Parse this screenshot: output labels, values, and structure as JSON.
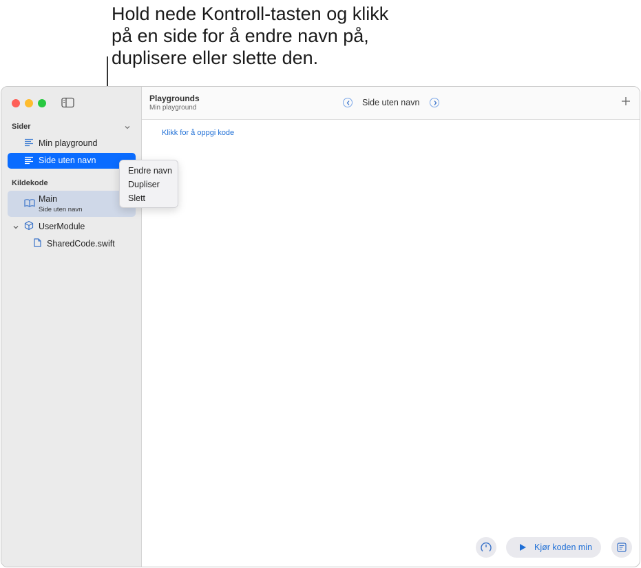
{
  "callout": {
    "text": "Hold nede Kontroll-tasten og klikk\npå en side for å endre navn på,\nduplisere eller slette den."
  },
  "sidebar": {
    "sections": {
      "pages": {
        "title": "Sider",
        "icon": "chevron-down-icon"
      },
      "source": {
        "title": "Kildekode"
      }
    },
    "pages": [
      {
        "label": "Min playground",
        "icon": "page-lines-icon",
        "selected": false
      },
      {
        "label": "Side uten navn",
        "icon": "page-lines-icon",
        "selected": true
      }
    ],
    "source_items": [
      {
        "label": "Main",
        "sublabel": "Side uten navn",
        "icon": "book-icon"
      },
      {
        "label": "UserModule",
        "icon": "cube-icon",
        "expanded": true
      },
      {
        "label": "SharedCode.swift",
        "icon": "document-icon"
      }
    ]
  },
  "toolbar": {
    "title": "Playgrounds",
    "subtitle": "Min playground",
    "page_name": "Side uten navn",
    "prev_icon": "chevron-left-circle-icon",
    "next_icon": "chevron-right-circle-icon",
    "add_icon": "plus-icon"
  },
  "editor": {
    "placeholder": "Klikk for å oppgi kode"
  },
  "bottom_bar": {
    "run_label": "Kjør koden min",
    "timer_icon": "speedometer-icon",
    "console_icon": "console-icon"
  },
  "context_menu": {
    "items": [
      "Endre navn",
      "Dupliser",
      "Slett"
    ]
  },
  "colors": {
    "accent": "#0a6cff",
    "link": "#1f6fd6",
    "sidebar_bg": "#ebebeb",
    "selected_secondary": "#cfd8e8"
  }
}
